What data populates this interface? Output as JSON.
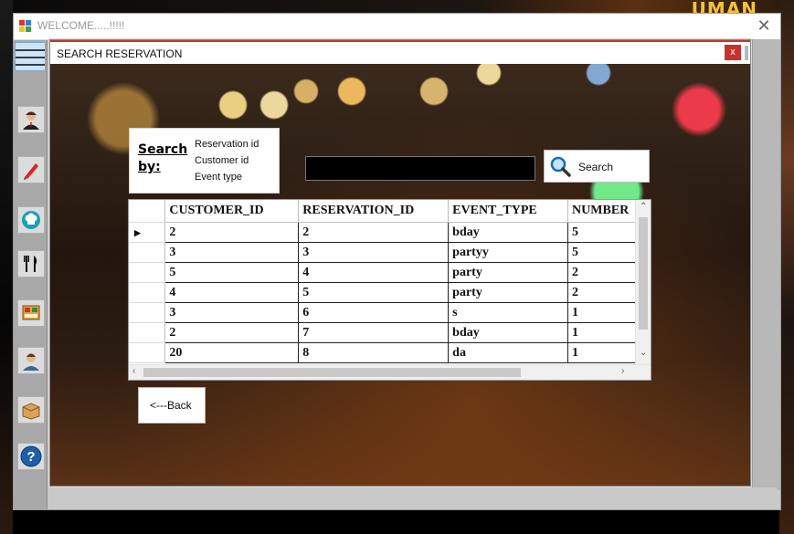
{
  "window": {
    "title": "WELCOME.....!!!!!",
    "close_glyph": "✕"
  },
  "background_text": "UMAN",
  "toolbar": {
    "icons": [
      "menu-icon",
      "user-icon",
      "pen-icon",
      "chef-hat-icon",
      "fork-knife-icon",
      "food-menu-icon",
      "staff-icon",
      "box-icon",
      "help-icon"
    ],
    "help_glyph": "?"
  },
  "dialog": {
    "title": "SEARCH RESERVATION",
    "close_glyph": "x",
    "search_by": {
      "label_line1": "Search",
      "label_line2": "by:",
      "options": [
        "Reservation id",
        "Customer id",
        "Event type"
      ]
    },
    "search_input": {
      "value": "",
      "placeholder": ""
    },
    "search_button": {
      "label": "Search"
    },
    "back_button": {
      "label": "<---Back"
    },
    "grid": {
      "columns": [
        "CUSTOMER_ID",
        "RESERVATION_ID",
        "EVENT_TYPE",
        "NUMBER"
      ],
      "rows": [
        [
          "2",
          "2",
          "bday",
          "5"
        ],
        [
          "3",
          "3",
          "partyy",
          "5"
        ],
        [
          "5",
          "4",
          "party",
          "2"
        ],
        [
          "4",
          "5",
          "party",
          "2"
        ],
        [
          "3",
          "6",
          "s",
          "1"
        ],
        [
          "2",
          "7",
          "bday",
          "1"
        ],
        [
          "20",
          "8",
          "da",
          "1"
        ]
      ],
      "current_row_marker": "▶"
    }
  },
  "colors": {
    "accent_close": "#c8322d",
    "title_border": "#c0392b",
    "input_bg": "#000000"
  }
}
